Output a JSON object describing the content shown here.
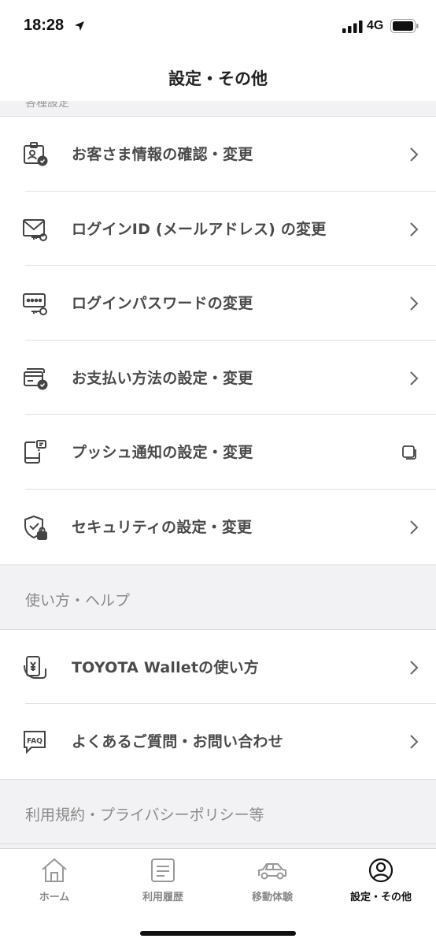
{
  "status_bar": {
    "time": "18:28",
    "network": "4G"
  },
  "header": {
    "title": "設定・その他"
  },
  "sections": {
    "partial_header": "各種設定",
    "account_items": [
      {
        "label": "お客さま情報の確認・変更",
        "icon": "profile-check-icon",
        "trailing": "chevron"
      },
      {
        "label": "ログインID (メールアドレス) の変更",
        "icon": "mail-key-icon",
        "trailing": "chevron"
      },
      {
        "label": "ログインパスワードの変更",
        "icon": "password-key-icon",
        "trailing": "chevron"
      },
      {
        "label": "お支払い方法の設定・変更",
        "icon": "card-check-icon",
        "trailing": "chevron"
      },
      {
        "label": "プッシュ通知の設定・変更",
        "icon": "phone-notification-icon",
        "trailing": "external"
      },
      {
        "label": "セキュリティの設定・変更",
        "icon": "shield-lock-icon",
        "trailing": "chevron"
      }
    ],
    "help_header": "使い方・ヘルプ",
    "help_items": [
      {
        "label": "TOYOTA Walletの使い方",
        "icon": "wallet-phone-icon",
        "trailing": "chevron"
      },
      {
        "label": "よくあるご質問・お問い合わせ",
        "icon": "faq-icon",
        "trailing": "chevron"
      }
    ],
    "terms_header": "利用規約・プライバシーポリシー等"
  },
  "tab_bar": {
    "tabs": [
      {
        "label": "ホーム",
        "icon": "home-icon",
        "active": false
      },
      {
        "label": "利用履歴",
        "icon": "history-icon",
        "active": false
      },
      {
        "label": "移動体験",
        "icon": "car-icon",
        "active": false
      },
      {
        "label": "設定・その他",
        "icon": "user-circle-icon",
        "active": true
      }
    ]
  },
  "colors": {
    "background": "#f2f2f4",
    "text_primary": "#4a4a4a",
    "active_tab": "#111111",
    "inactive_tab": "#888888"
  }
}
